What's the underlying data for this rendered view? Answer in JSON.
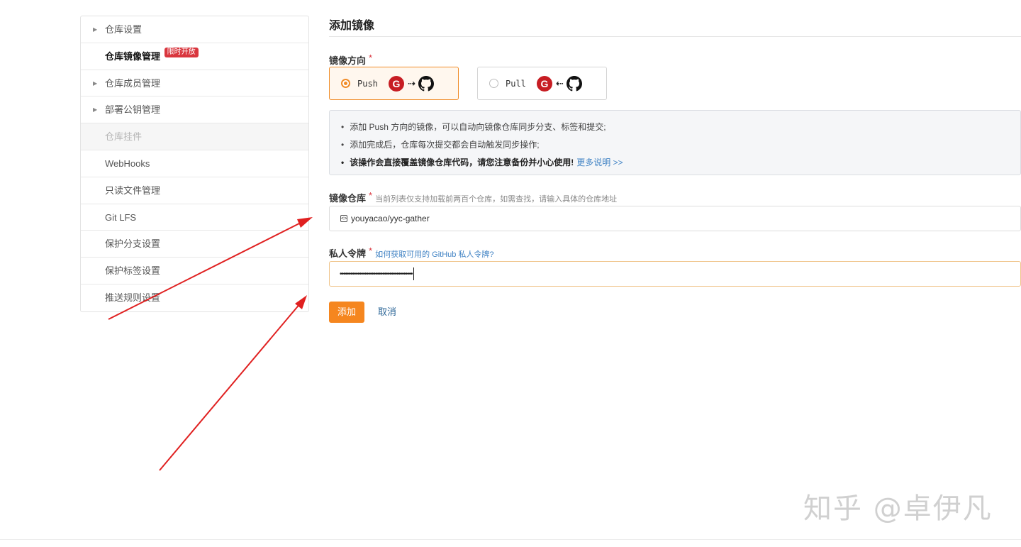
{
  "sidebar": {
    "items": [
      {
        "label": "仓库设置",
        "state": "collapsible"
      },
      {
        "label": "仓库镜像管理",
        "state": "active",
        "badge": "限时开放"
      },
      {
        "label": "仓库成员管理",
        "state": "collapsible"
      },
      {
        "label": "部署公钥管理",
        "state": "collapsible"
      },
      {
        "label": "仓库挂件",
        "state": "disabled"
      },
      {
        "label": "WebHooks",
        "state": "normal"
      },
      {
        "label": "只读文件管理",
        "state": "normal"
      },
      {
        "label": "Git LFS",
        "state": "normal"
      },
      {
        "label": "保护分支设置",
        "state": "normal"
      },
      {
        "label": "保护标签设置",
        "state": "normal"
      },
      {
        "label": "推送规则设置",
        "state": "normal"
      }
    ]
  },
  "main": {
    "title": "添加镜像",
    "direction": {
      "label": "镜像方向",
      "required_mark": "*",
      "push": {
        "label": "Push",
        "arrow": "⇢",
        "selected": true
      },
      "pull": {
        "label": "Pull",
        "arrow": "⇠",
        "selected": false
      }
    },
    "info": {
      "bullet": "•",
      "line1": "添加 Push 方向的镜像，可以自动向镜像仓库同步分支、标签和提交;",
      "line2": "添加完成后，仓库每次提交都会自动触发同步操作;",
      "line3": "该操作会直接覆盖镜像仓库代码，请您注意备份并小心使用!",
      "link": "更多说明 >>"
    },
    "repo": {
      "label": "镜像仓库",
      "required_mark": "*",
      "hint": "当前列表仅支持加载前两百个仓库，如需查找，请输入具体的仓库地址",
      "value": "youyacao/yyc-gather"
    },
    "token": {
      "label": "私人令牌",
      "required_mark": "*",
      "hint_link": "如何获取可用的 GitHub 私人令牌?",
      "value": "•••••••••••••••••••••••••••••••••••••••••"
    },
    "buttons": {
      "add": "添加",
      "cancel": "取消"
    }
  },
  "icons": {
    "gitee": "G",
    "repo": "<>"
  },
  "colors": {
    "accent": "#f5861f",
    "gitee_red": "#c71d23",
    "annotation_red": "#e02020",
    "link": "#4183c4"
  },
  "watermark": "知乎 @卓伊凡"
}
